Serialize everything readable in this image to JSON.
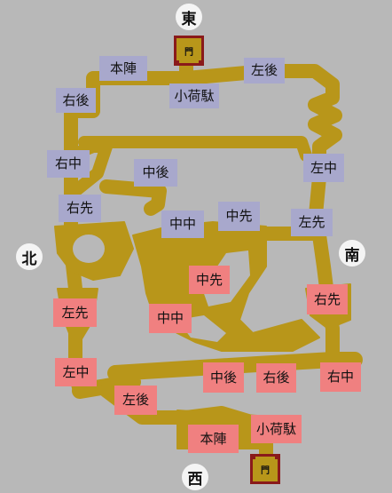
{
  "colors": {
    "background": "#b8b8b8",
    "path": "#b8961a",
    "east_team": "#a8a8cc",
    "west_team": "#f08080",
    "gate_border": "#8a1a1a"
  },
  "directions": {
    "east": "東",
    "west": "西",
    "north": "北",
    "south": "南"
  },
  "gates": {
    "top": "門",
    "bottom": "門"
  },
  "east_side": {
    "honjin": "本陣",
    "konidaeki": "小荷駄",
    "ugo": "右後",
    "sago": "左後",
    "uchu": "右中",
    "sachu": "左中",
    "chugo": "中後",
    "usen": "右先",
    "sasen": "左先",
    "chuchu": "中中",
    "chusen": "中先"
  },
  "west_side": {
    "honjin": "本陣",
    "konidaeki": "小荷駄",
    "sago": "左後",
    "ugo": "右後",
    "sachu": "左中",
    "uchu": "右中",
    "chugo": "中後",
    "sasen": "左先",
    "usen": "右先",
    "chuchu": "中中",
    "chusen": "中先"
  }
}
